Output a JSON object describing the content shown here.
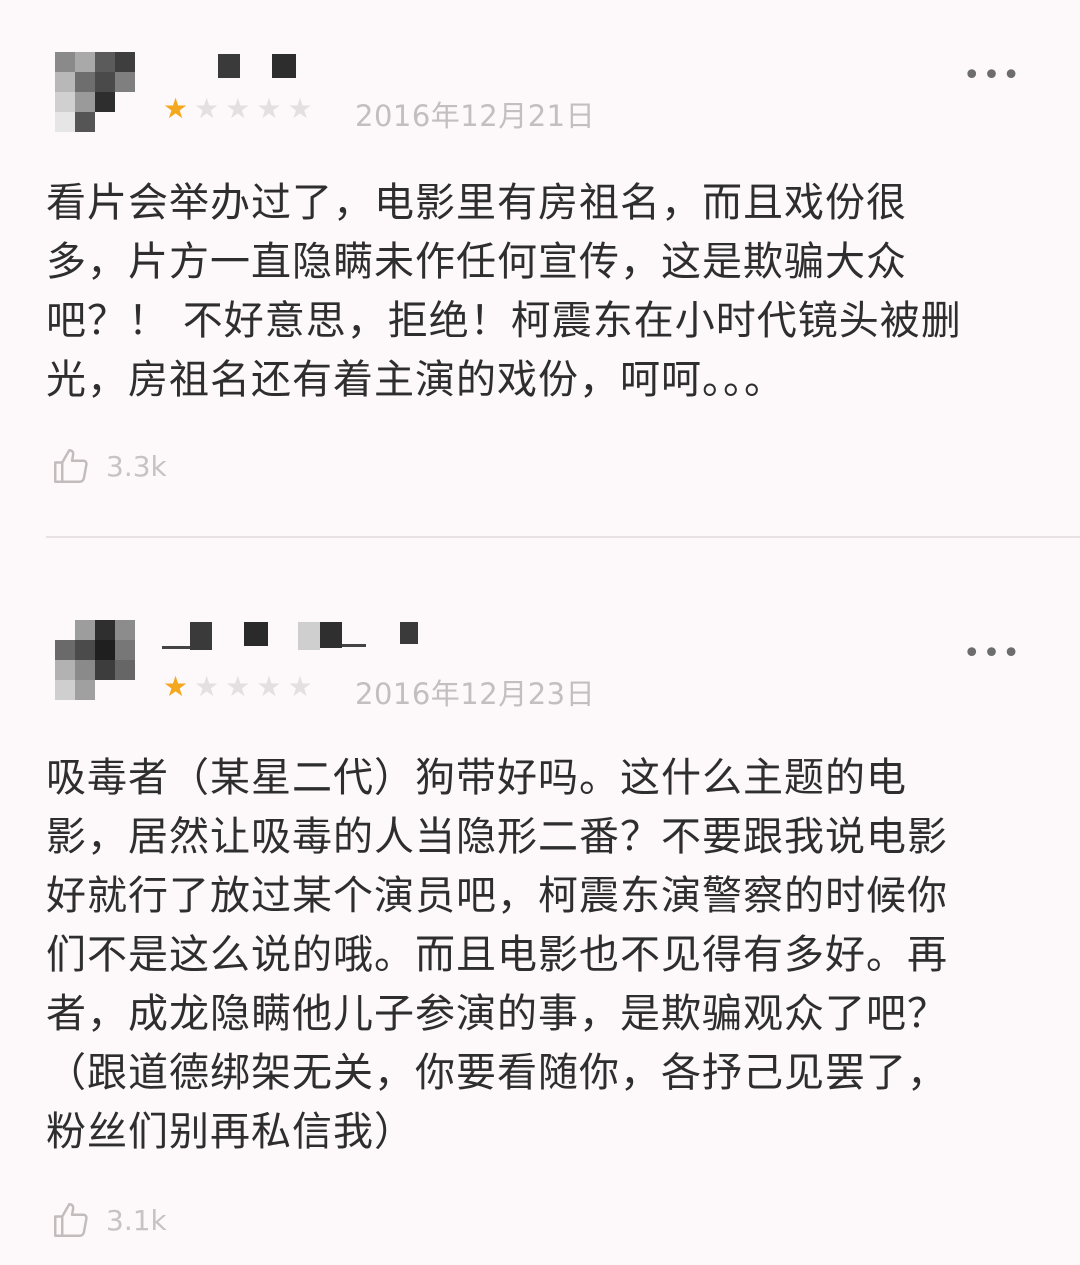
{
  "reviews": [
    {
      "rating_stars": 1,
      "rating_max": 5,
      "date": "2016年12月21日",
      "text": "看片会举办过了，电影里有房祖名，而且戏份很\n多，片方一直隐瞒未作任何宣传，这是欺骗大众\n吧？！ 不好意思，拒绝！柯震东在小时代镜头被删\n光，房祖名还有着主演的戏份，呵呵。。。",
      "likes": "3.3k",
      "more_icon": "more-dots-icon",
      "like_icon": "thumbs-up-icon"
    },
    {
      "rating_stars": 1,
      "rating_max": 5,
      "date": "2016年12月23日",
      "text": "吸毒者（某星二代）狗带好吗。这什么主题的电\n影，居然让吸毒的人当隐形二番？不要跟我说电影\n好就行了放过某个演员吧，柯震东演警察的时候你\n们不是这么说的哦。而且电影也不见得有多好。再\n者，成龙隐瞒他儿子参演的事，是欺骗观众了吧？\n（跟道德绑架无关，你要看随你，各抒己见罢了，\n粉丝们别再私信我）",
      "likes": "3.1k",
      "more_icon": "more-dots-icon",
      "like_icon": "thumbs-up-icon"
    }
  ],
  "colors": {
    "background": "#fdf8f9",
    "star_active": "#f4a81d",
    "star_inactive": "#e4e0e1",
    "meta_text": "#c3bfc0",
    "body_text": "#2e2e2e"
  }
}
